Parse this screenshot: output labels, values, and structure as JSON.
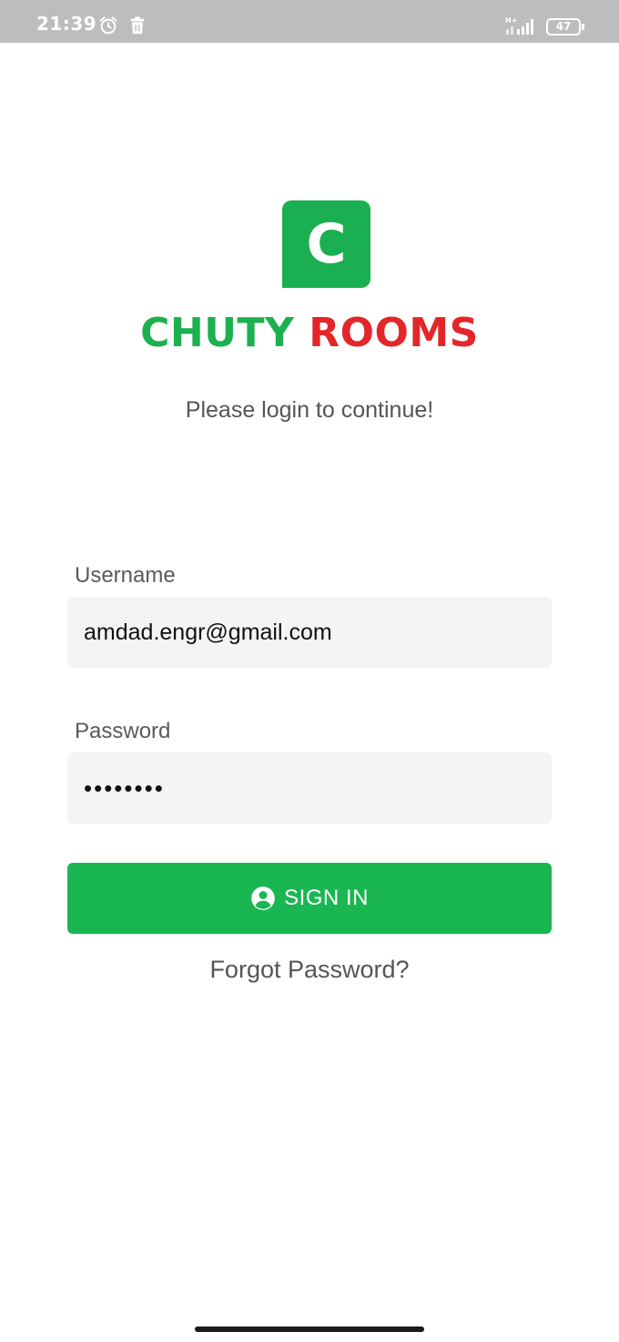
{
  "status_bar": {
    "time": "21:39",
    "battery_level": "47",
    "icons": [
      "alarm-icon",
      "trash-icon",
      "signal-icon",
      "battery-icon"
    ]
  },
  "logo": {
    "letter": "C",
    "brand_part1": "CHUTY",
    "brand_part2": "ROOMS",
    "box_color": "#1aaf50",
    "green_color": "#1db04e",
    "red_color": "#e3262a"
  },
  "login": {
    "subtitle": "Please login to continue!",
    "username_label": "Username",
    "username_value": "amdad.engr@gmail.com",
    "password_label": "Password",
    "password_value": "••••••••",
    "sign_in_label": "SIGN IN",
    "sign_in_icon": "user-circle-icon",
    "forgot_label": "Forgot Password?",
    "button_color": "#1ab651"
  }
}
